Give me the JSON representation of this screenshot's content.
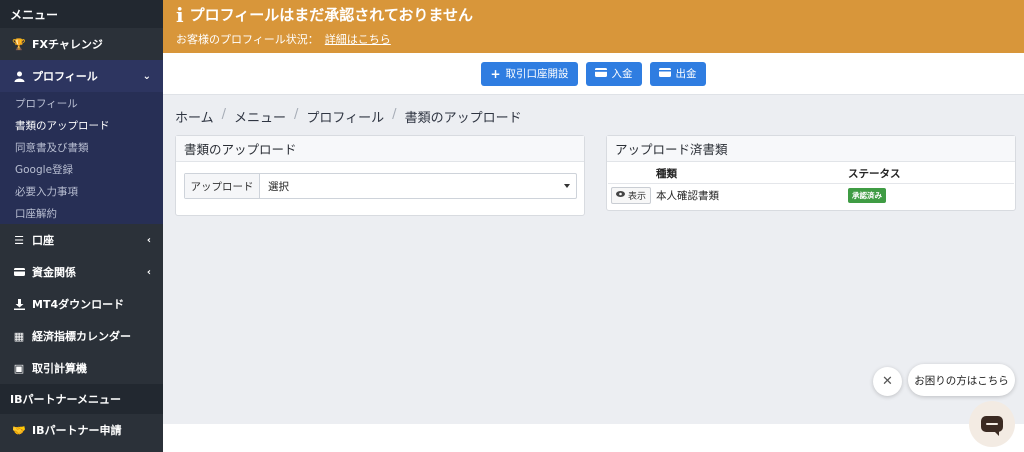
{
  "sidebar": {
    "header": "メニュー",
    "items": [
      {
        "label": "FXチャレンジ",
        "icon": "trophy-icon"
      },
      {
        "label": "プロフィール",
        "icon": "user-icon",
        "chevron": "chevron-down-icon"
      }
    ],
    "profile_subitems": [
      "プロフィール",
      "書類のアップロード",
      "同意書及び書類",
      "Google登録",
      "必要入力事項",
      "口座解約"
    ],
    "items_after": [
      {
        "label": "口座",
        "icon": "list-icon"
      },
      {
        "label": "資金関係",
        "icon": "wallet-icon"
      },
      {
        "label": "MT4ダウンロード",
        "icon": "download-icon"
      },
      {
        "label": "経済指標カレンダー",
        "icon": "calendar-icon"
      },
      {
        "label": "取引計算機",
        "icon": "calculator-icon"
      }
    ],
    "ib_section": "IBパートナーメニュー",
    "ib_items": [
      {
        "label": "IBパートナー申請",
        "icon": "handshake-icon"
      }
    ]
  },
  "alert": {
    "title": "プロフィールはまだ承認されておりません",
    "subtitle": "お客様のプロフィール状況：",
    "link": "詳細はこちら",
    "color": "#d8963a"
  },
  "toolbar": {
    "open_account": "取引口座開設",
    "deposit": "入金",
    "withdraw": "出金",
    "button_color": "#2f7de1"
  },
  "breadcrumb": [
    "ホーム",
    "メニュー",
    "プロフィール",
    "書類のアップロード"
  ],
  "upload": {
    "title": "書類のアップロード",
    "label": "アップロード",
    "selected": "選択"
  },
  "docs": {
    "title": "アップロード済書類",
    "headers": [
      "種類",
      "ステータス"
    ],
    "rows": [
      {
        "action": "表示",
        "type": "本人確認書類",
        "status": "承認済み"
      }
    ],
    "status_color": "#3f9c44"
  },
  "help": {
    "bubble": "お困りの方はこちら"
  }
}
